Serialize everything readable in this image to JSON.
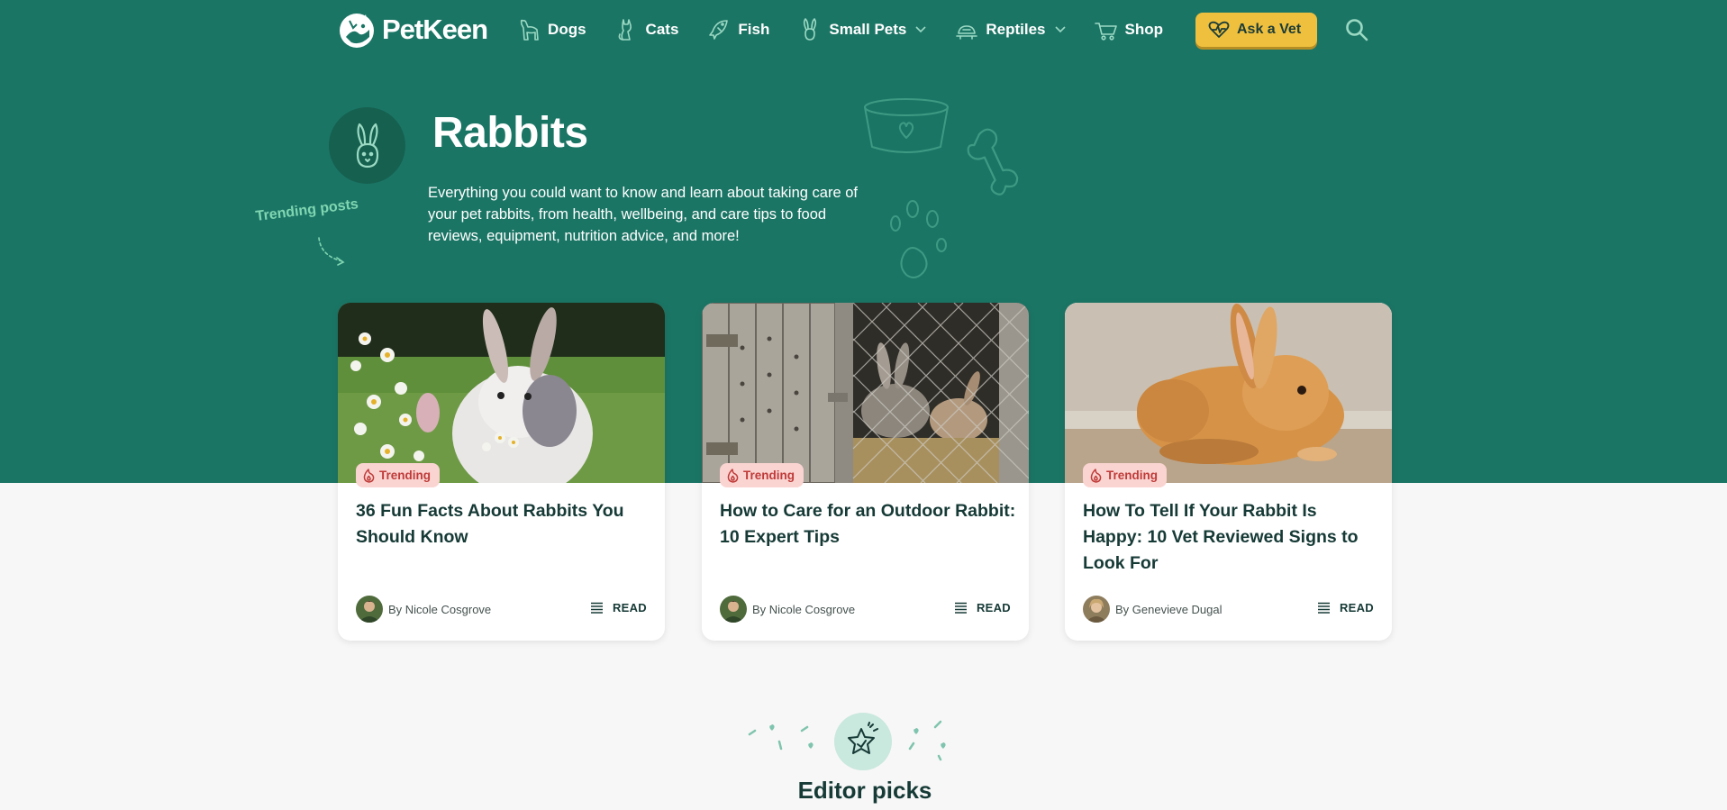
{
  "brand": {
    "name": "PetKeen"
  },
  "nav": {
    "items": [
      {
        "label": "Dogs",
        "icon": "dog-icon",
        "dropdown": false
      },
      {
        "label": "Cats",
        "icon": "cat-icon",
        "dropdown": false
      },
      {
        "label": "Fish",
        "icon": "fish-icon",
        "dropdown": false
      },
      {
        "label": "Small Pets",
        "icon": "rabbit-icon",
        "dropdown": true
      },
      {
        "label": "Reptiles",
        "icon": "turtle-icon",
        "dropdown": true
      },
      {
        "label": "Shop",
        "icon": "cart-icon",
        "dropdown": false
      }
    ],
    "ask_vet": "Ask a Vet"
  },
  "hero": {
    "title": "Rabbits",
    "description": "Everything you could want to know and learn about taking care of your pet rabbits, from health, wellbeing, and care tips to food reviews, equipment, nutrition advice, and more!",
    "trending_note": "Trending posts"
  },
  "cards": [
    {
      "tag": "Trending",
      "title": "36 Fun Facts About Rabbits You Should Know",
      "author": "By Nicole Cosgrove",
      "read": "READ"
    },
    {
      "tag": "Trending",
      "title": "How to Care for an Outdoor Rabbit: 10 Expert Tips",
      "author": "By Nicole Cosgrove",
      "read": "READ"
    },
    {
      "tag": "Trending",
      "title": "How To Tell If Your Rabbit Is Happy: 10 Vet Reviewed Signs to Look For",
      "author": "By Genevieve Dugal",
      "read": "READ"
    }
  ],
  "editor_picks": {
    "title": "Editor picks"
  },
  "colors": {
    "primary": "#1b7565",
    "accent": "#efc03d",
    "tag_bg": "#fad4d1",
    "tag_text": "#bf3b39",
    "text_dark": "#163a36"
  }
}
